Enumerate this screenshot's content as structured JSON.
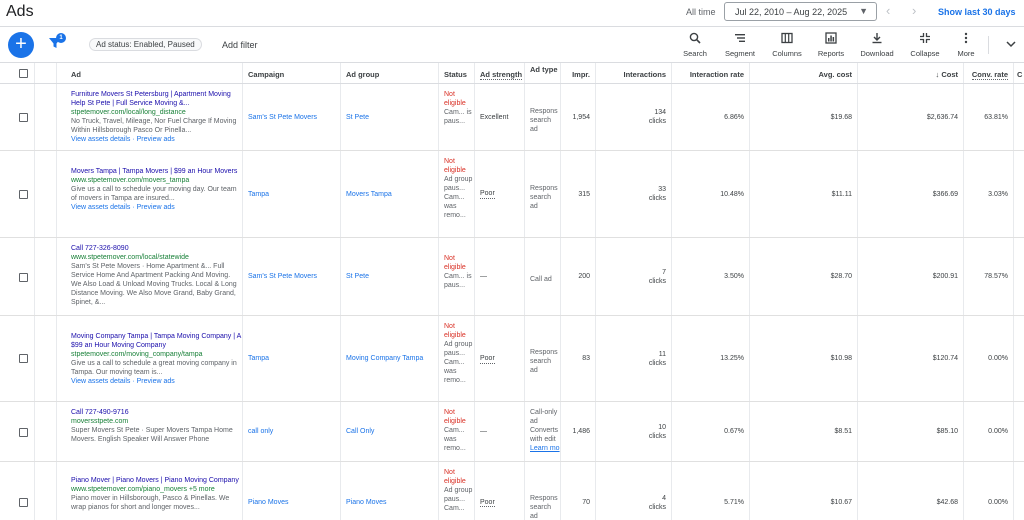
{
  "header": {
    "title": "Ads",
    "all_time_label": "All time",
    "date_range": "Jul 22, 2010 – Aug 22, 2025",
    "show_last": "Show last 30 days"
  },
  "toolbar": {
    "filter_badge": "1",
    "chip": "Ad status: Enabled, Paused",
    "add_filter": "Add filter",
    "tools": [
      {
        "label": "Search",
        "icon": "search-icon"
      },
      {
        "label": "Segment",
        "icon": "segment-icon"
      },
      {
        "label": "Columns",
        "icon": "columns-icon"
      },
      {
        "label": "Reports",
        "icon": "reports-icon"
      },
      {
        "label": "Download",
        "icon": "download-icon"
      },
      {
        "label": "Collapse",
        "icon": "collapse-icon"
      },
      {
        "label": "More",
        "icon": "more-vert-icon"
      }
    ]
  },
  "columns": {
    "ad": "Ad",
    "campaign": "Campaign",
    "ad_group": "Ad group",
    "status": "Status",
    "ad_strength": "Ad strength",
    "ad_type": "Ad type",
    "impr": "Impr.",
    "interactions": "Interactions",
    "interaction_rate": "Interaction rate",
    "avg_cost": "Avg. cost",
    "cost": "Cost",
    "cost_sort_arrow": "↓",
    "conv_rate": "Conv. rate",
    "next_col": "C"
  },
  "rows": [
    {
      "ad_title": "Furniture Movers St Petersburg | Apartment Moving Help St Pete | Full Service Moving &...",
      "ad_url": "stpetemover.com/local/long_distance",
      "ad_desc": "No Truck, Travel, Mileage, Nor Fuel Charge If Moving Within Hillsborough Pasco Or Pinella...",
      "ad_links": "View assets details · Preview ads",
      "campaign": "Sam's St Pete Movers",
      "ad_group": "St Pete",
      "status_main": "Not eligible",
      "status_sub": "Cam... is paus...",
      "ad_strength": "Excellent",
      "ad_type": "Respons search ad",
      "ad_type_link": "",
      "impr": "1,954",
      "interactions": "134",
      "interactions_unit": "clicks",
      "interaction_rate": "6.86%",
      "avg_cost": "$19.68",
      "cost": "$2,636.74",
      "conv_rate": "63.81%"
    },
    {
      "ad_title": "Movers Tampa | Tampa Movers | $99 an Hour Movers",
      "ad_url": "www.stpetemover.com/movers_tampa",
      "ad_desc": "Give us a call to schedule your moving day. Our team of movers in Tampa are insured...",
      "ad_links": "View assets details · Preview ads",
      "campaign": "Tampa",
      "ad_group": "Movers Tampa",
      "status_main": "Not eligible",
      "status_sub": "Ad group paus... Cam... was remo...",
      "ad_strength": "Poor",
      "ad_type": "Respons search ad",
      "ad_type_link": "",
      "impr": "315",
      "interactions": "33",
      "interactions_unit": "clicks",
      "interaction_rate": "10.48%",
      "avg_cost": "$11.11",
      "cost": "$366.69",
      "conv_rate": "3.03%"
    },
    {
      "ad_title": "Call 727-326-8090",
      "ad_url": "www.stpetemover.com/local/statewide",
      "ad_desc": "Sam's St Pete Movers · Home Apartment &... Full Service Home And Apartment Packing And Moving. We Also Load & Unload Moving Trucks. Local & Long Distance Moving. We Also Move Grand, Baby Grand, Spinet, &...",
      "ad_links": "",
      "campaign": "Sam's St Pete Movers",
      "ad_group": "St Pete",
      "status_main": "Not eligible",
      "status_sub": "Cam... is paus...",
      "ad_strength": "—",
      "ad_type": "Call ad",
      "ad_type_link": "",
      "impr": "200",
      "interactions": "7",
      "interactions_unit": "clicks",
      "interaction_rate": "3.50%",
      "avg_cost": "$28.70",
      "cost": "$200.91",
      "conv_rate": "78.57%"
    },
    {
      "ad_title": "Moving Company Tampa | Tampa Moving Company | A $99 an Hour Moving Company",
      "ad_url": "stpetemover.com/moving_company/tampa",
      "ad_desc": "Give us a call to schedule a great moving company in Tampa. Our moving team is...",
      "ad_links": "View assets details · Preview ads",
      "campaign": "Tampa",
      "ad_group": "Moving Company Tampa",
      "status_main": "Not eligible",
      "status_sub": "Ad group paus... Cam... was remo...",
      "ad_strength": "Poor",
      "ad_type": "Respons search ad",
      "ad_type_link": "",
      "impr": "83",
      "interactions": "11",
      "interactions_unit": "clicks",
      "interaction_rate": "13.25%",
      "avg_cost": "$10.98",
      "cost": "$120.74",
      "conv_rate": "0.00%"
    },
    {
      "ad_title": "Call 727-490-9716",
      "ad_url": "moversstpete.com",
      "ad_desc": "Super Movers St Pete · Super Movers Tampa Home Movers. English Speaker Will Answer Phone",
      "ad_links": "",
      "campaign": "call only",
      "ad_group": "Call Only",
      "status_main": "Not eligible",
      "status_sub": "Cam... was remo...",
      "ad_strength": "—",
      "ad_type": "Call-only ad Converts with edit",
      "ad_type_link": "Learn mo",
      "impr": "1,486",
      "interactions": "10",
      "interactions_unit": "clicks",
      "interaction_rate": "0.67%",
      "avg_cost": "$8.51",
      "cost": "$85.10",
      "conv_rate": "0.00%"
    },
    {
      "ad_title": "Piano Mover | Piano Movers | Piano Moving Company",
      "ad_url": "www.stpetemover.com/piano_movers  +5 more",
      "ad_desc": "Piano mover in Hillsborough, Pasco & Pinellas. We wrap pianos for short and longer moves...",
      "ad_links": "",
      "campaign": "Piano Moves",
      "ad_group": "Piano Moves",
      "status_main": "Not eligible",
      "status_sub": "Ad group paus... Cam...",
      "ad_strength": "Poor",
      "ad_type": "Respons search ad",
      "ad_type_link": "",
      "impr": "70",
      "interactions": "4",
      "interactions_unit": "clicks",
      "interaction_rate": "5.71%",
      "avg_cost": "$10.67",
      "cost": "$42.68",
      "conv_rate": "0.00%"
    }
  ]
}
